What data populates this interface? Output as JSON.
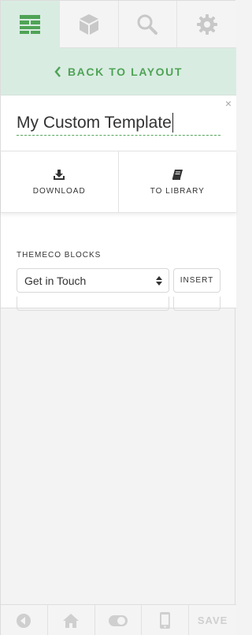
{
  "tabs": [
    {
      "icon": "layout-icon",
      "active": true
    },
    {
      "icon": "cube-icon",
      "active": false
    },
    {
      "icon": "search-icon",
      "active": false
    },
    {
      "icon": "gear-icon",
      "active": false
    }
  ],
  "back": {
    "label": "BACK TO LAYOUT"
  },
  "panel": {
    "close": "×",
    "title_value": "My Custom Template",
    "actions": {
      "download_label": "DOWNLOAD",
      "library_label": "TO LIBRARY"
    },
    "blocks": {
      "section_label": "THEMECO BLOCKS",
      "selected": "Get in Touch",
      "insert_label": "INSERT"
    }
  },
  "bottom": {
    "items": [
      "back-icon",
      "home-icon",
      "toggle-icon",
      "mobile-icon"
    ],
    "save_label": "SAVE"
  },
  "colors": {
    "accent": "#4fa356",
    "tab_active_bg": "#d9ece2",
    "icon_inactive": "#c8c8c8"
  }
}
